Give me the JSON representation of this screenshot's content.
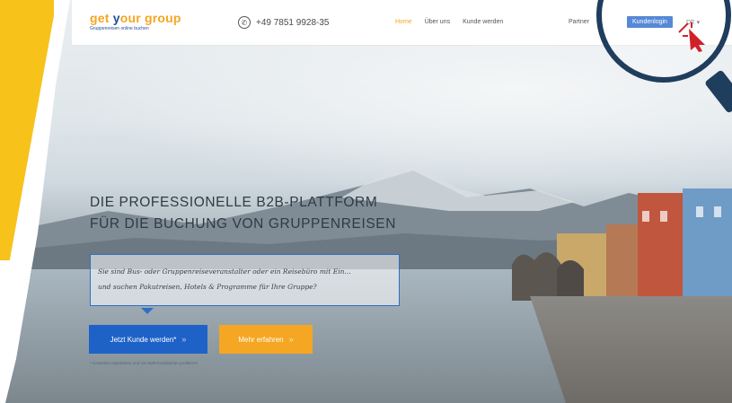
{
  "logo": {
    "name_part1": "get ",
    "name_part2": "y",
    "name_part3": "our group",
    "tagline": "Gruppenreisen online buchen"
  },
  "header": {
    "phone": "+49 7851 9928-35",
    "nav": [
      "Home",
      "Über uns",
      "Kunde werden"
    ],
    "partner_label": "Partner",
    "login_button": "Kundenlogin",
    "language": "DE"
  },
  "hero": {
    "headline_line1": "DIE PROFESSIONELLE B2B-PLATTFORM",
    "headline_line2": "FÜR DIE BUCHUNG VON GRUPPENREISEN",
    "script_line1": "Sie sind Bus- oder Gruppenreiseveranstalter oder ein Reisebüro mit Ein...",
    "script_line2": "und suchen Pakutreisen, Hotels & Programme für Ihre Gruppe?",
    "cta_primary": "Jetzt Kunde werden*",
    "cta_secondary": "Mehr erfahren",
    "footnote": "* Kostenlos registrieren und von B2B-Konditionen profitieren"
  },
  "colors": {
    "accent_orange": "#f5a623",
    "accent_blue": "#1e62c8",
    "banner_yellow": "#f7c21a",
    "magnifier": "#1f3d5c"
  },
  "icons": {
    "phone": "phone-icon",
    "chevron": "chevron-right-icon",
    "cursor": "mouse-cursor-icon",
    "magnifier": "magnifier-icon"
  }
}
